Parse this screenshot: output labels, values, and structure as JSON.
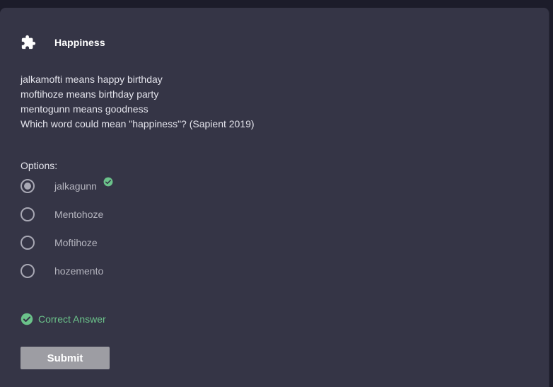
{
  "card": {
    "title": "Happiness",
    "icon": "puzzle-icon"
  },
  "question": {
    "lines": [
      "jalkamofti means happy birthday",
      "moftihoze means birthday party",
      "mentogunn means goodness",
      "Which word could mean \"happiness\"? (Sapient 2019)"
    ]
  },
  "options": {
    "label": "Options:",
    "items": [
      {
        "label": "jalkagunn",
        "selected": true,
        "correct": true
      },
      {
        "label": "Mentohoze",
        "selected": false,
        "correct": false
      },
      {
        "label": "Moftihoze",
        "selected": false,
        "correct": false
      },
      {
        "label": "hozemento",
        "selected": false,
        "correct": false
      }
    ]
  },
  "result": {
    "text": "Correct Answer",
    "icon": "check-circle-icon"
  },
  "submit": {
    "label": "Submit"
  },
  "colors": {
    "background": "#1c1c2a",
    "card": "#353546",
    "correct": "#6bc28a",
    "button": "#9d9da3"
  }
}
